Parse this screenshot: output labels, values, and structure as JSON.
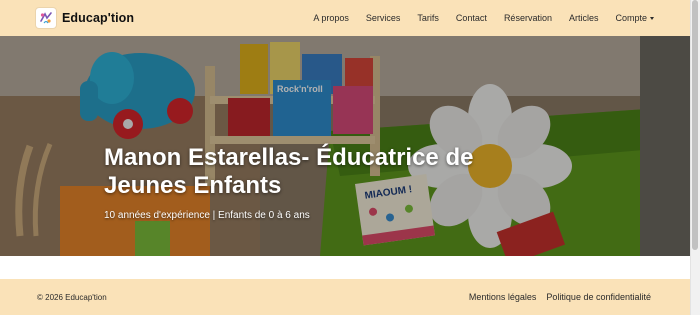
{
  "navbar": {
    "brand": "Educap'tion",
    "links": [
      "A propos",
      "Services",
      "Tarifs",
      "Contact",
      "Réservation",
      "Articles"
    ],
    "account_label": "Compte",
    "background": "#fae2b8"
  },
  "hero": {
    "title_line1": "Manon Estarellas- Éducatrice de",
    "title_line2": "Jeunes Enfants",
    "subtitle": "10 années d'expérience | Enfants de 0 à 6 ans",
    "photo_book_text_1": "Rock'n'roll",
    "photo_book_text_2": "MIAOUM !"
  },
  "footer": {
    "copyright": "© 2026 Educap'tion",
    "links": [
      "Mentions légales",
      "Politique de confidentialité"
    ]
  }
}
